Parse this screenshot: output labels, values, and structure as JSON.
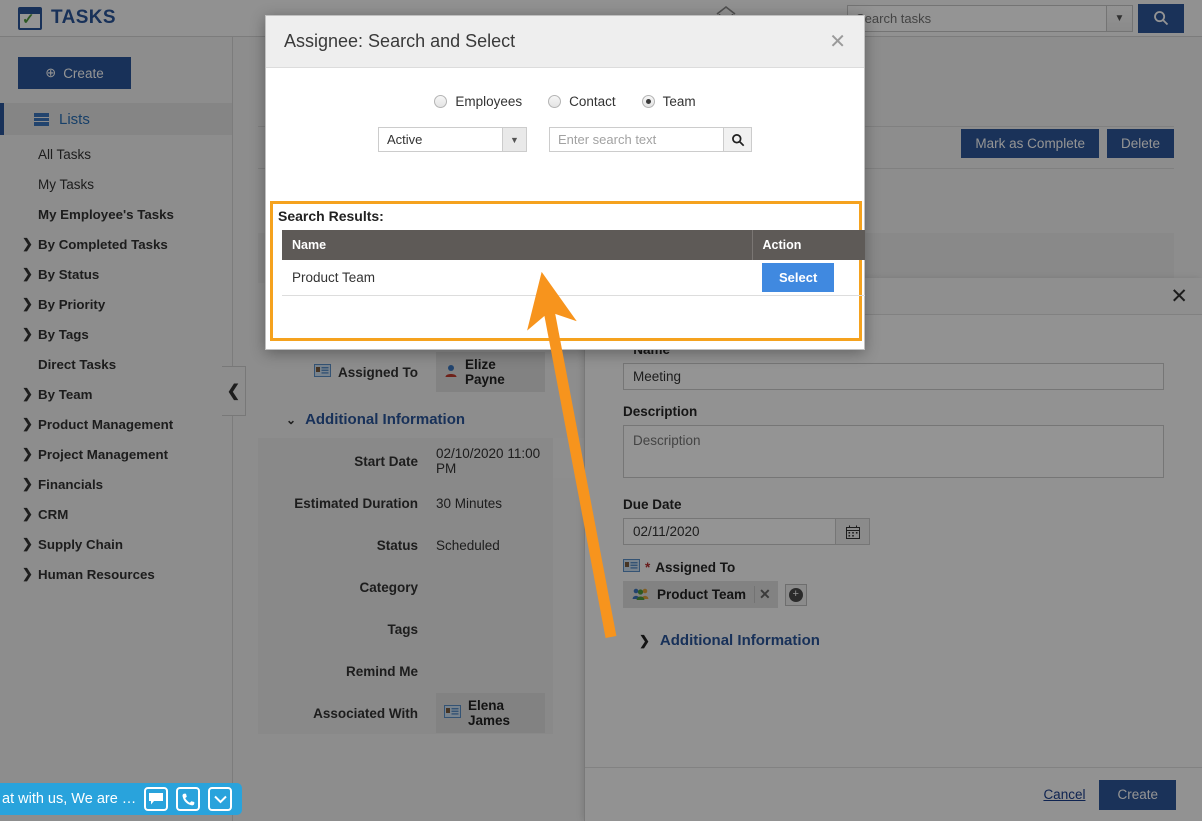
{
  "app": {
    "brand": "TASKS",
    "home_icon": "home-icon"
  },
  "topsearch": {
    "value": "Search tasks",
    "placeholder": "Search tasks",
    "caret": "▼",
    "button_icon": "search-icon"
  },
  "sidebar": {
    "create_label": "Create",
    "items": [
      {
        "label": "Lists",
        "icon": "grid-icon",
        "selected": true,
        "expandable": false
      },
      {
        "label": "All Tasks",
        "expandable": false
      },
      {
        "label": "My Tasks",
        "expandable": false
      },
      {
        "label": "My Employee's Tasks",
        "expandable": false
      },
      {
        "label": "By Completed Tasks",
        "expandable": true
      },
      {
        "label": "By Status",
        "expandable": true
      },
      {
        "label": "By Priority",
        "expandable": true
      },
      {
        "label": "By Tags",
        "expandable": true
      },
      {
        "label": "Direct Tasks",
        "expandable": false
      },
      {
        "label": "By Team",
        "expandable": true
      },
      {
        "label": "Product Management",
        "expandable": true
      },
      {
        "label": "Project Management",
        "expandable": true
      },
      {
        "label": "Financials",
        "expandable": true
      },
      {
        "label": "CRM",
        "expandable": true
      },
      {
        "label": "Supply Chain",
        "expandable": true
      },
      {
        "label": "Human Resources",
        "expandable": true
      }
    ],
    "collapse_glyph": "❮"
  },
  "main": {
    "mark_complete_label": "Mark as Complete",
    "delete_label": "Delete",
    "record": {
      "assigned_to_label": "Assigned To",
      "assigned_to_value": "Elize Payne",
      "section_title": "Additional Information",
      "section_caret": "⌄",
      "fields": [
        {
          "label": "Start Date",
          "value": "02/10/2020 11:00 PM"
        },
        {
          "label": "Estimated Duration",
          "value": "30 Minutes"
        },
        {
          "label": "Status",
          "value": "Scheduled"
        },
        {
          "label": "Category",
          "value": ""
        },
        {
          "label": "Tags",
          "value": ""
        },
        {
          "label": "Remind Me",
          "value": ""
        }
      ],
      "associated_with_label": "Associated With",
      "associated_with_value": "Elena James"
    }
  },
  "slideover": {
    "close_glyph": "✕",
    "name_label": "Name",
    "name_value": "Meeting",
    "description_label": "Description",
    "description_placeholder": "Description",
    "due_date_label": "Due Date",
    "due_date_value": "02/11/2020",
    "calendar_icon": "calendar-icon",
    "assigned_to_label": "Assigned To",
    "assigned_to_chip": "Product Team",
    "chip_remove_glyph": "✕",
    "add_glyph": "+",
    "additional_info_label": "Additional Information",
    "additional_info_caret": "❯",
    "cancel_label": "Cancel",
    "create_label": "Create"
  },
  "modal": {
    "title": "Assignee: Search and Select",
    "close_glyph": "✕",
    "radios": [
      {
        "label": "Employees",
        "selected": false
      },
      {
        "label": "Contact",
        "selected": false
      },
      {
        "label": "Team",
        "selected": true
      }
    ],
    "status_filter": {
      "value": "Active",
      "caret": "▼"
    },
    "search": {
      "value": "",
      "placeholder": "Enter search text",
      "button_icon": "search-icon"
    },
    "results_label": "Search Results:",
    "table": {
      "columns": [
        "Name",
        "Action"
      ],
      "rows": [
        {
          "name": "Product Team",
          "action_label": "Select"
        }
      ]
    }
  },
  "annotation": {
    "arrow_color": "#F7941D",
    "arrow_from": "610,636",
    "arrow_to": "545,292"
  },
  "chat": {
    "text": "at with us, We are …",
    "icons": [
      "chat-bubble-icon",
      "phone-icon",
      "chevron-down-icon"
    ]
  },
  "colors": {
    "brand_blue": "#2a5599",
    "accent_orange": "#F7941D",
    "select_blue": "#4089e0",
    "table_header": "#5e5a57",
    "chat_blue": "#29a3dc"
  }
}
